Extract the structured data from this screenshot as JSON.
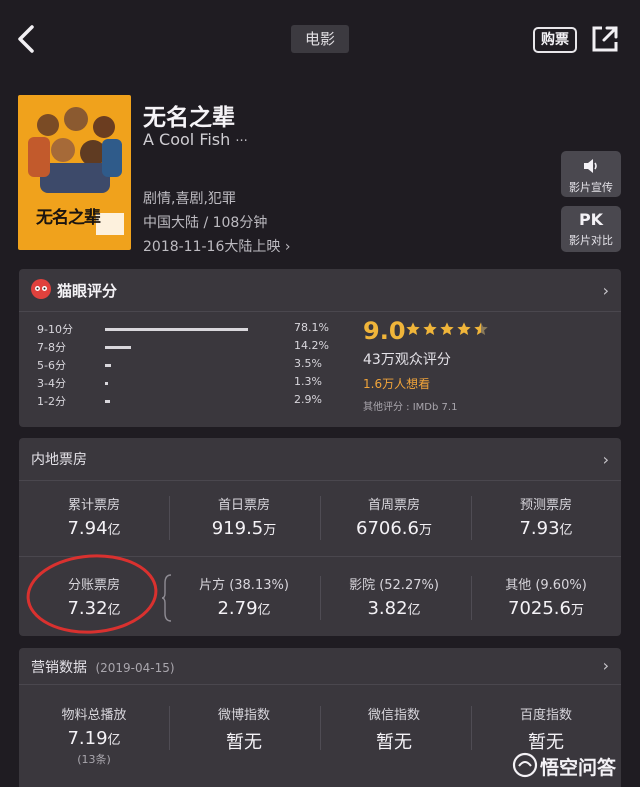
{
  "header": {
    "category": "电影",
    "buy_label": "购票"
  },
  "movie": {
    "title": "无名之辈",
    "subtitle": "A Cool Fish",
    "more": "···",
    "genres": "剧情,喜剧,犯罪",
    "region_duration": "中国大陆 / 108分钟",
    "release": "2018-11-16大陆上映",
    "poster_title": "无名之辈"
  },
  "side_buttons": [
    {
      "icon": "speaker-icon",
      "label": "影片宣传"
    },
    {
      "icon_text": "PK",
      "label": "影片对比"
    }
  ],
  "rating": {
    "header": "猫眼评分",
    "score": "9.0",
    "stars": 4.5,
    "voters": "43万观众评分",
    "want": "1.6万人想看",
    "other": "其他评分 : IMDb 7.1",
    "distribution": [
      {
        "label": "9-10分",
        "pct_text": "78.1%",
        "pct": 78.1
      },
      {
        "label": "7-8分",
        "pct_text": "14.2%",
        "pct": 14.2
      },
      {
        "label": "5-6分",
        "pct_text": "3.5%",
        "pct": 3.5
      },
      {
        "label": "3-4分",
        "pct_text": "1.3%",
        "pct": 1.3
      },
      {
        "label": "1-2分",
        "pct_text": "2.9%",
        "pct": 2.9
      }
    ]
  },
  "box_office": {
    "header": "内地票房",
    "row1": [
      {
        "label": "累计票房",
        "value": "7.94",
        "unit": "亿"
      },
      {
        "label": "首日票房",
        "value": "919.5",
        "unit": "万"
      },
      {
        "label": "首周票房",
        "value": "6706.6",
        "unit": "万"
      },
      {
        "label": "预测票房",
        "value": "7.93",
        "unit": "亿"
      }
    ],
    "row2": [
      {
        "label": "分账票房",
        "value": "7.32",
        "unit": "亿"
      },
      {
        "label": "片方 (38.13%)",
        "value": "2.79",
        "unit": "亿"
      },
      {
        "label": "影院 (52.27%)",
        "value": "3.82",
        "unit": "亿"
      },
      {
        "label": "其他 (9.60%)",
        "value": "7025.6",
        "unit": "万"
      }
    ]
  },
  "marketing": {
    "header": "营销数据",
    "date": "(2019-04-15)",
    "items": [
      {
        "label": "物料总播放",
        "value": "7.19",
        "unit": "亿",
        "note": "(13条)"
      },
      {
        "label": "微博指数",
        "value": "暂无"
      },
      {
        "label": "微信指数",
        "value": "暂无"
      },
      {
        "label": "百度指数",
        "value": "暂无"
      }
    ]
  },
  "watermark": "悟空问答",
  "colors": {
    "background": "#1f1c22",
    "card": "#3a373d",
    "accent_red": "#e0413d",
    "star_gold": "#f0b53a",
    "want_orange": "#f1a43a",
    "annotation_red": "#d9312f"
  }
}
